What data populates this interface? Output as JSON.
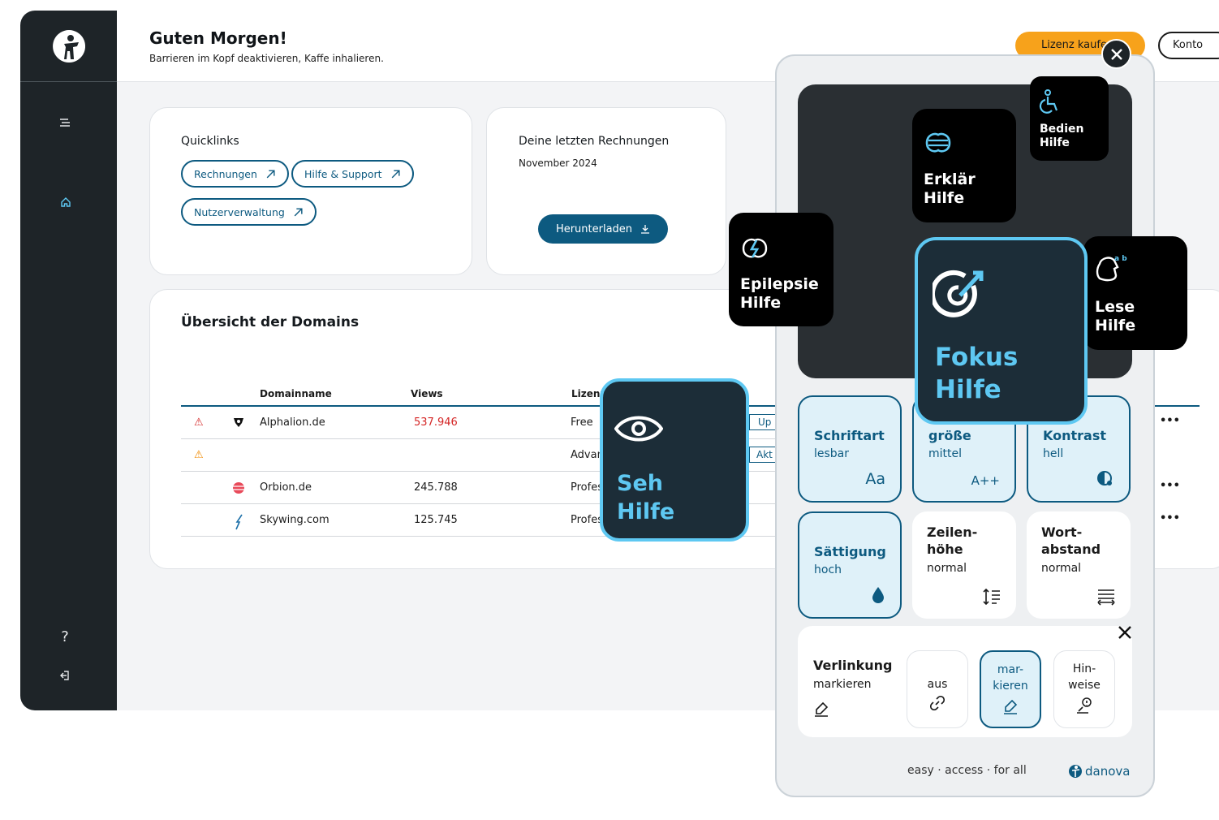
{
  "header": {
    "greeting": "Guten Morgen!",
    "subtitle": "Barrieren im Kopf deaktivieren, Kaffe inhalieren.",
    "buy_license": "Lizenz kaufen",
    "account": "Konto"
  },
  "quicklinks": {
    "title": "Quicklinks",
    "links": [
      "Rechnungen",
      "Hilfe & Support",
      "Nutzerverwaltung"
    ]
  },
  "invoices": {
    "title": "Deine letzten Rechnungen",
    "month": "November 2024",
    "download": "Herunterladen"
  },
  "domains": {
    "title": "Übersicht der Domains",
    "columns": [
      "Domainname",
      "Views",
      "Lizenz"
    ],
    "rows": [
      {
        "name": "Alphalion.de",
        "views": "537.946",
        "license": "Free",
        "action": "Up",
        "warn": "red"
      },
      {
        "name": "",
        "views": "",
        "license": "Advan",
        "action": "Akt",
        "warn": "orange"
      },
      {
        "name": "Orbion.de",
        "views": "245.788",
        "license": "Profes",
        "action": "",
        "warn": ""
      },
      {
        "name": "Skywing.com",
        "views": "125.745",
        "license": "Profes",
        "action": "",
        "warn": ""
      }
    ],
    "more": "•••"
  },
  "widget": {
    "tiles": {
      "erklaer": [
        "Erklär",
        "Hilfe"
      ],
      "bedien": [
        "Bedien",
        "Hilfe"
      ],
      "epilepsie": [
        "Epilepsie",
        "Hilfe"
      ],
      "fokus": [
        "Fokus",
        "Hilfe"
      ],
      "lese": [
        "Lese",
        "Hilfe"
      ],
      "seh": [
        "Seh",
        "Hilfe"
      ]
    },
    "options": [
      {
        "title": "Schriftart",
        "value": "lesbar",
        "icon": "Aa"
      },
      {
        "title": "größe",
        "value": "mittel",
        "icon": "A++"
      },
      {
        "title": "Kontrast",
        "value": "hell",
        "icon": ""
      },
      {
        "title": "Sättigung",
        "value": "hoch",
        "icon": ""
      },
      {
        "title": "Zeilen-\nhöhe",
        "value": "normal",
        "icon": ""
      },
      {
        "title": "Wort-\nabstand",
        "value": "normal",
        "icon": ""
      }
    ],
    "links": {
      "title": "Verlinkung",
      "value": "markieren",
      "off": "aus",
      "mark": "mar-\nkieren",
      "hints": "Hin-\nweise"
    },
    "footer": "easy · access · for all",
    "brand": "danova"
  },
  "colors": {
    "primary": "#0d5a80",
    "dark": "#1e2428",
    "accent": "#f7a21b",
    "focus": "#5ec8f2",
    "warn_red": "#d42424",
    "warn_orange": "#f08a00"
  }
}
